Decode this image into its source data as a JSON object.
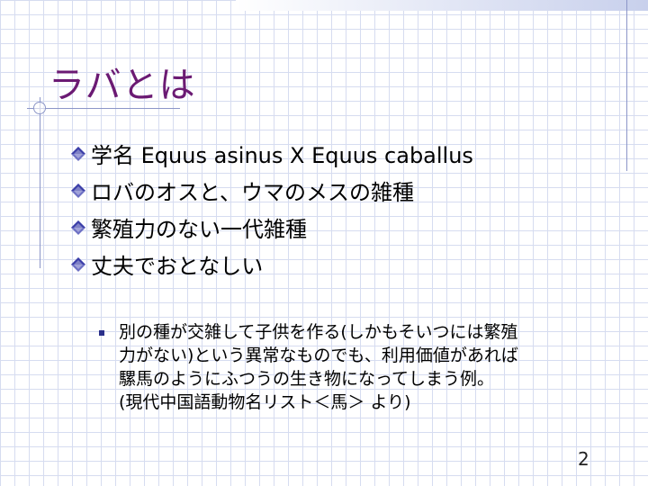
{
  "slide": {
    "title": "ラバとは",
    "bullets": [
      "学名 Equus asinus  X  Equus caballus",
      "ロバのオスと、ウマのメスの雑種",
      "繁殖力のない一代雑種",
      "丈夫でおとなしい"
    ],
    "sub_bullet": "別の種が交雑して子供を作る(しかもそいつには繁殖\n力がない)という異常なものでも、利用価値があれば\n騾馬のようにふつうの生き物になってしまう例。\n(現代中国語動物名リスト＜馬＞ より)",
    "page_number": "2",
    "bullet_icon": "diamond-bullet-icon",
    "sub_bullet_icon": "square-bullet-icon",
    "colors": {
      "title": "#6b1a73",
      "grid": "#d6dcf0",
      "accent_lines": "#8c96c8",
      "diamond_top": "#3b3ea8",
      "sub_square": "#2a2f8a"
    }
  }
}
